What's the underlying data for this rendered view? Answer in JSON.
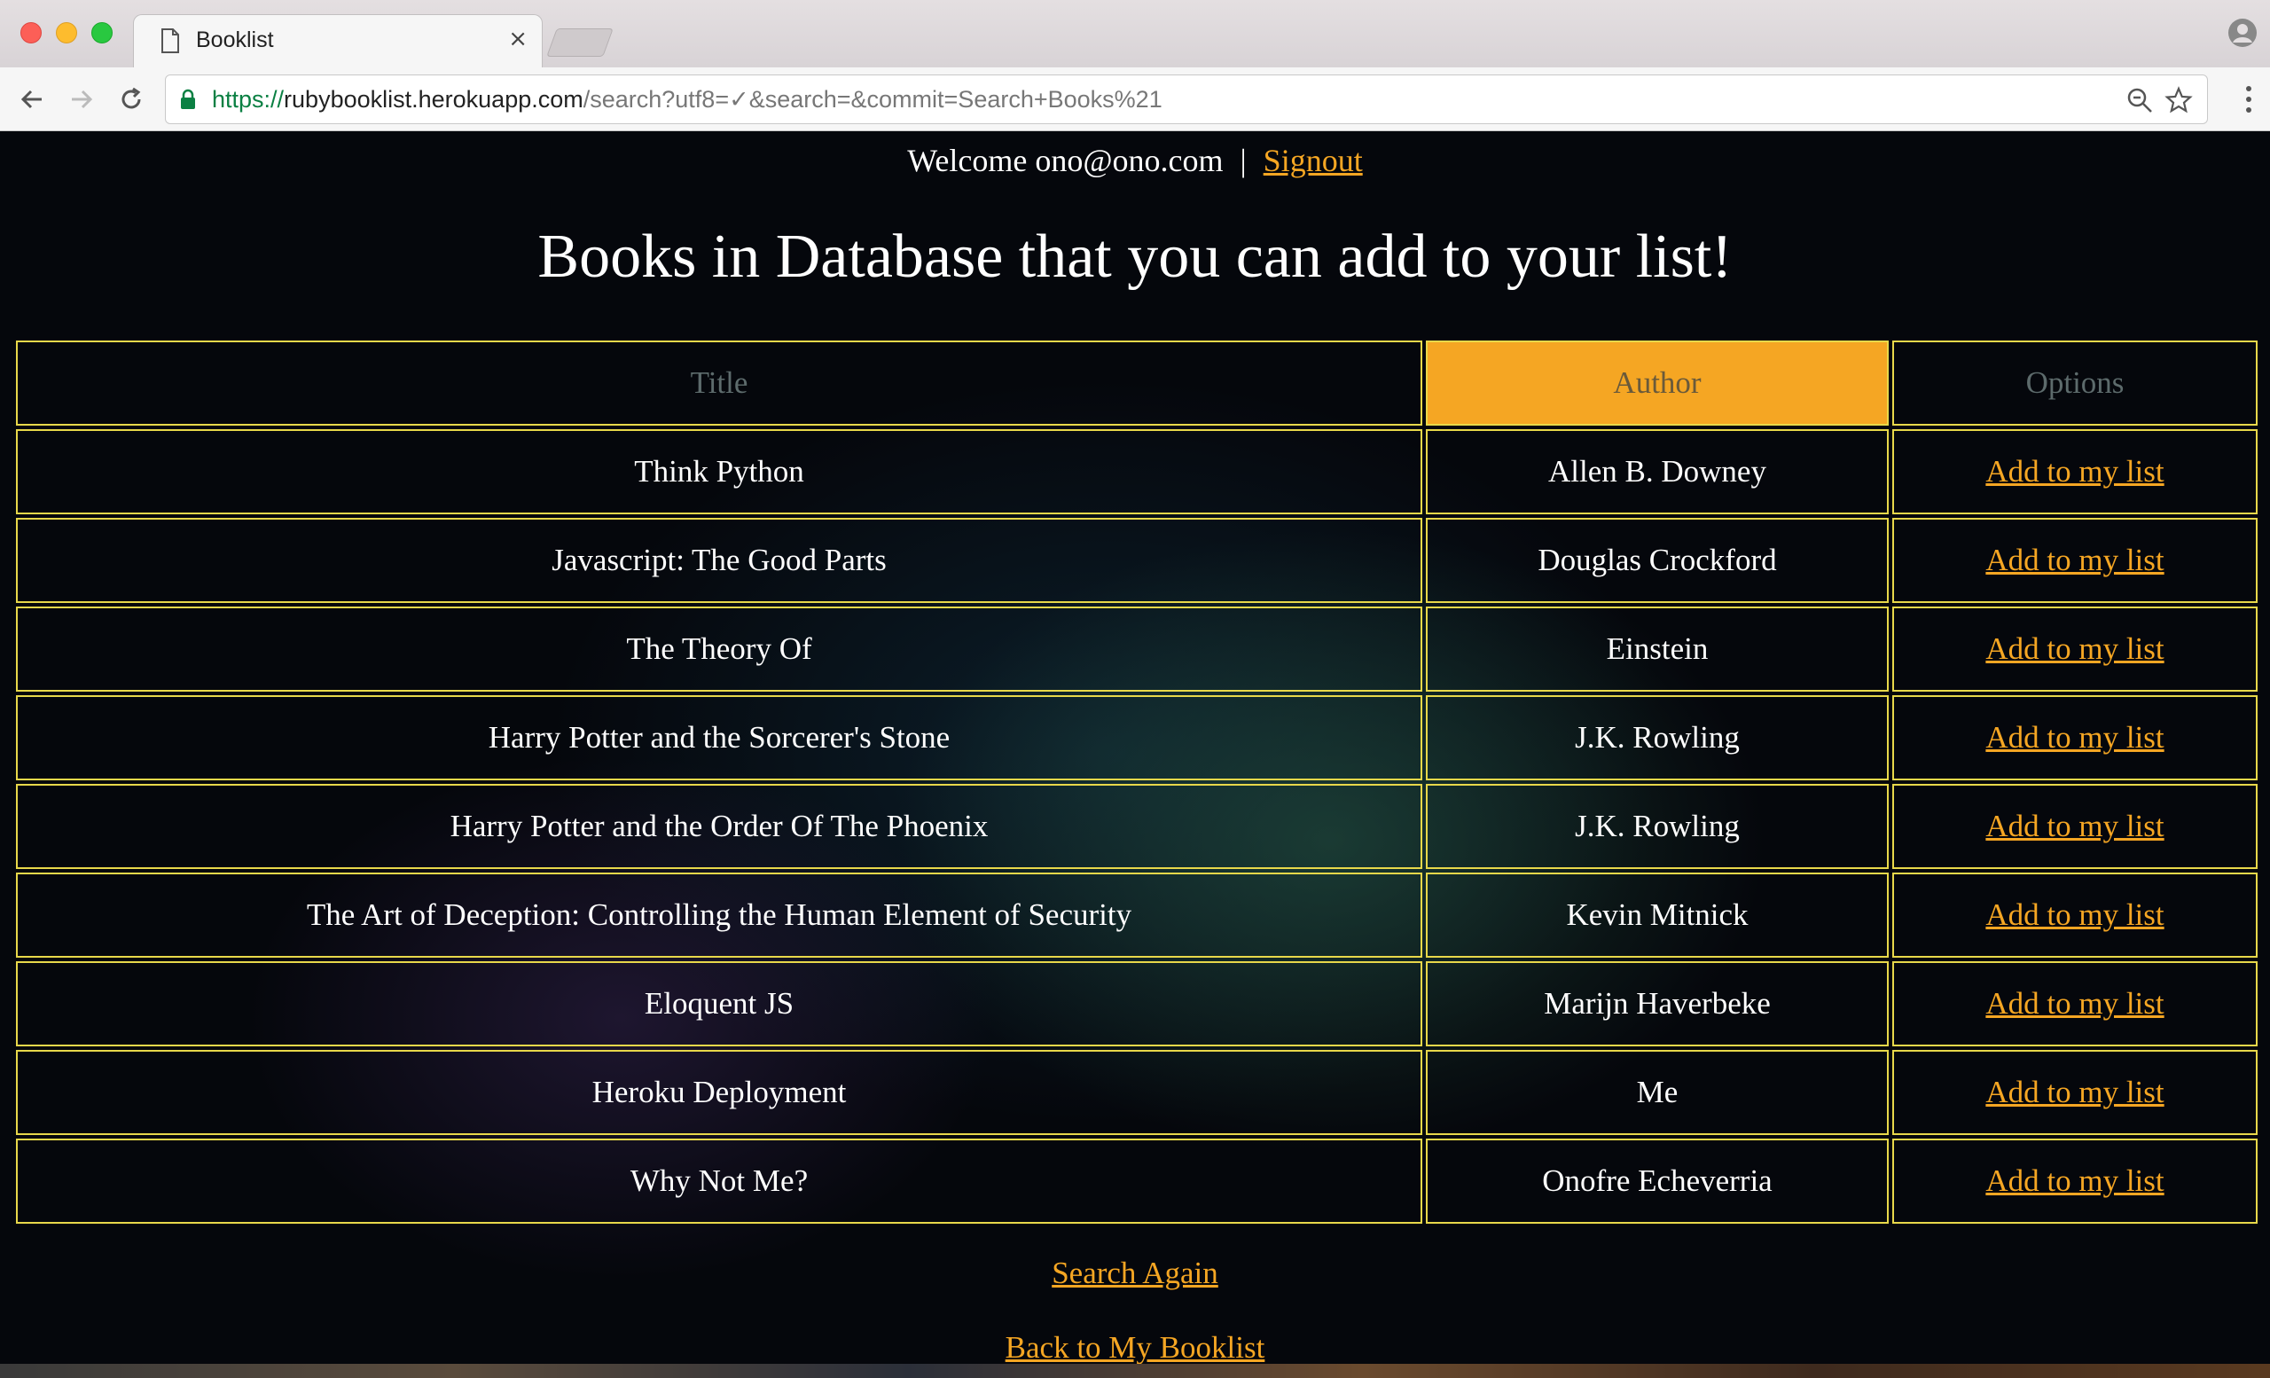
{
  "browser": {
    "tab_title": "Booklist",
    "tab_close": "×",
    "url_scheme": "https://",
    "url_host": "rubybooklist.herokuapp.com",
    "url_path": "/search?utf8=✓&search=&commit=Search+Books%21"
  },
  "header": {
    "welcome_text": "Welcome ono@ono.com",
    "separator": "|",
    "signout_label": "Signout"
  },
  "main": {
    "heading": "Books in Database that you can add to your list!"
  },
  "table": {
    "columns": [
      "Title",
      "Author",
      "Options"
    ],
    "sorted_column": "Author",
    "rows": [
      {
        "title": "Think Python",
        "author": "Allen B. Downey",
        "action": "Add to my list"
      },
      {
        "title": "Javascript: The Good Parts",
        "author": "Douglas Crockford",
        "action": "Add to my list"
      },
      {
        "title": "The Theory Of",
        "author": "Einstein",
        "action": "Add to my list"
      },
      {
        "title": "Harry Potter and the Sorcerer's Stone",
        "author": "J.K. Rowling",
        "action": "Add to my list"
      },
      {
        "title": "Harry Potter and the Order Of The Phoenix",
        "author": "J.K. Rowling",
        "action": "Add to my list"
      },
      {
        "title": "The Art of Deception: Controlling the Human Element of Security",
        "author": "Kevin Mitnick",
        "action": "Add to my list"
      },
      {
        "title": "Eloquent JS",
        "author": "Marijn Haverbeke",
        "action": "Add to my list"
      },
      {
        "title": "Heroku Deployment",
        "author": "Me",
        "action": "Add to my list"
      },
      {
        "title": "Why Not Me?",
        "author": "Onofre Echeverria",
        "action": "Add to my list"
      }
    ]
  },
  "footer": {
    "search_again_label": "Search Again",
    "back_label": "Back to My Booklist"
  },
  "colors": {
    "link": "#f5a623",
    "border": "#e8d84a",
    "sorted_header": "#f5a623"
  }
}
